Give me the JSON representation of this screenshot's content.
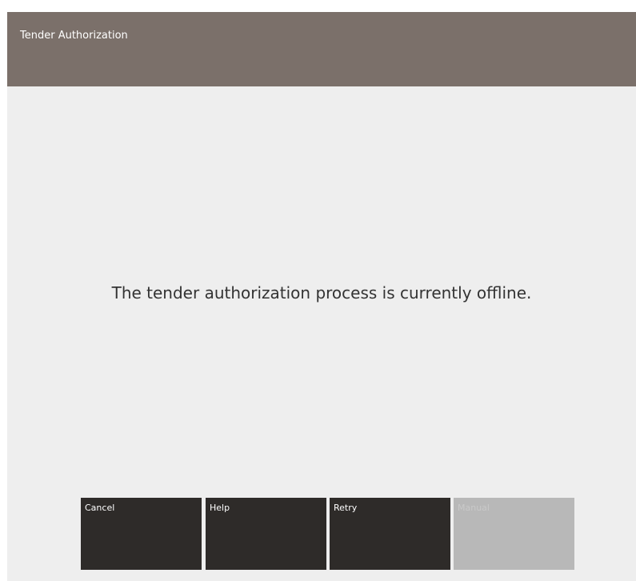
{
  "window": {
    "title": "Tender Authorization"
  },
  "main": {
    "message": "The tender authorization process is currently offline."
  },
  "buttons": [
    {
      "label": "Cancel",
      "enabled": true
    },
    {
      "label": "Help",
      "enabled": true
    },
    {
      "label": "Retry",
      "enabled": true
    },
    {
      "label": "Manual",
      "enabled": false
    }
  ],
  "colors": {
    "titlebar": "#7b706a",
    "background": "#eeeeee",
    "button": "#2e2b29",
    "button_disabled": "#b8b8b8",
    "message_text": "#333333"
  }
}
